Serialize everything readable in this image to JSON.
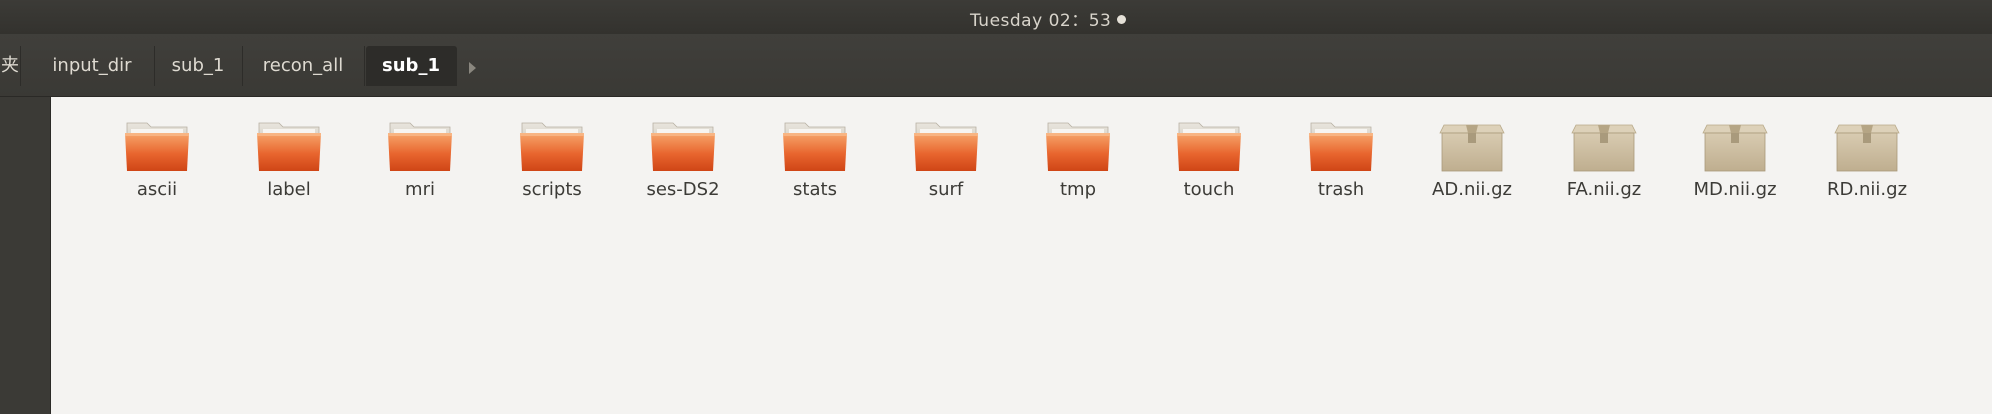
{
  "topbar": {
    "clock": "Tuesday 02：53"
  },
  "pathbar": {
    "crumbs": [
      {
        "label": "夹"
      },
      {
        "label": "input_dir"
      },
      {
        "label": "sub_1"
      },
      {
        "label": "recon_all"
      },
      {
        "label": "sub_1"
      }
    ]
  },
  "files": [
    {
      "name": "ascii",
      "kind": "folder-icon"
    },
    {
      "name": "label",
      "kind": "folder-icon"
    },
    {
      "name": "mri",
      "kind": "folder-icon"
    },
    {
      "name": "scripts",
      "kind": "folder-icon"
    },
    {
      "name": "ses-DS2",
      "kind": "folder-icon"
    },
    {
      "name": "stats",
      "kind": "folder-icon"
    },
    {
      "name": "surf",
      "kind": "folder-icon"
    },
    {
      "name": "tmp",
      "kind": "folder-icon"
    },
    {
      "name": "touch",
      "kind": "folder-icon"
    },
    {
      "name": "trash",
      "kind": "folder-icon"
    },
    {
      "name": "AD.nii.gz",
      "kind": "archive-icon"
    },
    {
      "name": "FA.nii.gz",
      "kind": "archive-icon"
    },
    {
      "name": "MD.nii.gz",
      "kind": "archive-icon"
    },
    {
      "name": "RD.nii.gz",
      "kind": "archive-icon"
    }
  ],
  "colors": {
    "folder_top": "#f39a5c",
    "folder_bottom": "#d7461b",
    "archive_body": "#c9b99b"
  }
}
